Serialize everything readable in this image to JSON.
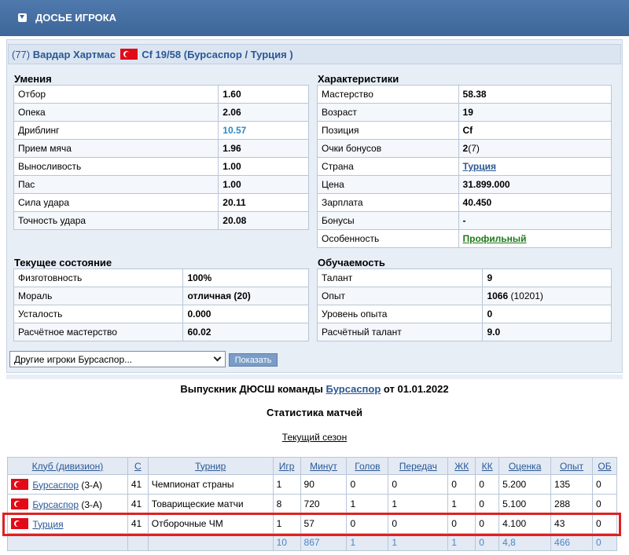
{
  "page_title": "ДОСЬЕ ИГРОКА",
  "header": {
    "number": "(77)",
    "name": "Вардар Хартмас",
    "position_age": "Cf 19/58",
    "club": "Бурсаспор",
    "country": "Турция",
    "open_paren": "(",
    "slash": "/",
    "close_paren": ")"
  },
  "skills": {
    "title": "Умения",
    "rows": [
      {
        "label": "Отбор",
        "value": "1.60"
      },
      {
        "label": "Опека",
        "value": "2.06"
      },
      {
        "label": "Дриблинг",
        "value": "10.57"
      },
      {
        "label": "Прием мяча",
        "value": "1.96"
      },
      {
        "label": "Выносливость",
        "value": "1.00"
      },
      {
        "label": "Пас",
        "value": "1.00"
      },
      {
        "label": "Сила удара",
        "value": "20.11"
      },
      {
        "label": "Точность удара",
        "value": "20.08"
      }
    ]
  },
  "characteristics": {
    "title": "Характеристики",
    "rows": [
      {
        "label": "Мастерство",
        "value": "58.38"
      },
      {
        "label": "Возраст",
        "value": "19"
      },
      {
        "label": "Позиция",
        "value": "Cf"
      },
      {
        "label": "Очки бонусов",
        "value": "2",
        "extra": "(7)"
      },
      {
        "label": "Страна",
        "value": "Турция"
      },
      {
        "label": "Цена",
        "value": "31.899.000"
      },
      {
        "label": "Зарплата",
        "value": "40.450"
      },
      {
        "label": "Бонусы",
        "value": "-"
      },
      {
        "label": "Особенность",
        "value": "Профильный"
      }
    ]
  },
  "condition": {
    "title": "Текущее состояние",
    "rows": [
      {
        "label": "Физготовность",
        "value": "100%"
      },
      {
        "label": "Мораль",
        "value": "отличная (20)"
      },
      {
        "label": "Усталость",
        "value": "0.000"
      },
      {
        "label": "Расчётное мастерство",
        "value": "60.02"
      }
    ]
  },
  "learning": {
    "title": "Обучаемость",
    "rows": [
      {
        "label": "Талант",
        "value": "9"
      },
      {
        "label": "Опыт",
        "value": "1066",
        "extra": "(10201)"
      },
      {
        "label": "Уровень опыта",
        "value": "0"
      },
      {
        "label": "Расчётный талант",
        "value": "9.0"
      }
    ]
  },
  "select": {
    "value": "Другие игроки Бурсаспор..."
  },
  "show_button": "Показать",
  "graduate": {
    "prefix": "Выпускник ДЮСШ команды",
    "club": "Бурсаспор",
    "suffix": "от 01.01.2022"
  },
  "stats_title": "Статистика матчей",
  "season_link": "Текущий сезон",
  "stats": {
    "headers": [
      "Клуб (дивизион)",
      "С",
      "Турнир",
      "Игр",
      "Минут",
      "Голов",
      "Передач",
      "ЖК",
      "КК",
      "Оценка",
      "Опыт",
      "ОБ"
    ],
    "rows": [
      {
        "club": "Бурсаспор",
        "div": "(3-А)",
        "c": "41",
        "tournament": "Чемпионат страны",
        "games": "1",
        "minutes": "90",
        "goals": "0",
        "assists": "0",
        "yc": "0",
        "rc": "0",
        "rating": "5.200",
        "exp": "135",
        "ob": "0"
      },
      {
        "club": "Бурсаспор",
        "div": "(3-А)",
        "c": "41",
        "tournament": "Товарищеские матчи",
        "games": "8",
        "minutes": "720",
        "goals": "1",
        "assists": "1",
        "yc": "1",
        "rc": "0",
        "rating": "5.100",
        "exp": "288",
        "ob": "0"
      },
      {
        "club": "Турция",
        "div": "",
        "c": "41",
        "tournament": "Отборочные ЧМ",
        "games": "1",
        "minutes": "57",
        "goals": "0",
        "assists": "0",
        "yc": "0",
        "rc": "0",
        "rating": "4.100",
        "exp": "43",
        "ob": "0"
      }
    ],
    "totals": {
      "games": "10",
      "minutes": "867",
      "goals": "1",
      "assists": "1",
      "yc": "1",
      "rc": "0",
      "rating": "4,8",
      "exp": "466",
      "ob": "0"
    }
  }
}
